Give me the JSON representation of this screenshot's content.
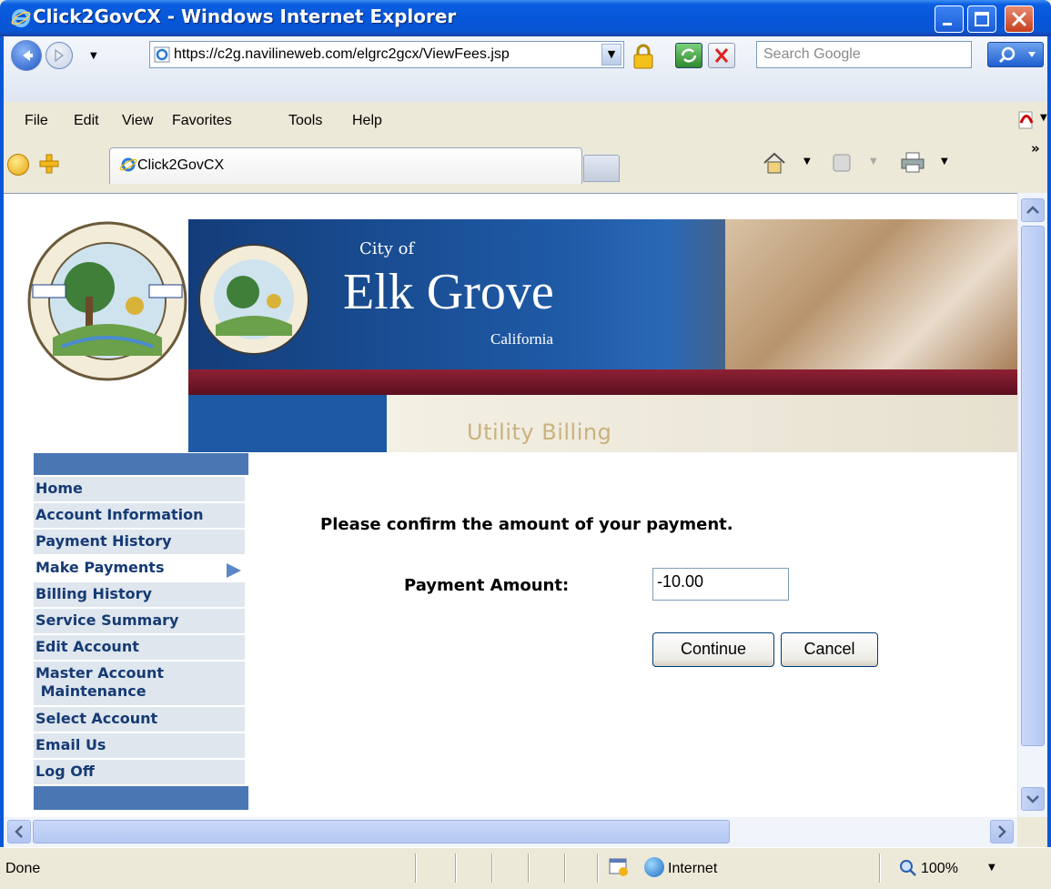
{
  "window": {
    "title": "Click2GovCX - Windows Internet Explorer"
  },
  "address_bar": {
    "url": "https://c2g.navilineweb.com/elgrc2gcx/ViewFees.jsp",
    "search_placeholder": "Search Google"
  },
  "menu": {
    "items": [
      "File",
      "Edit",
      "View",
      "Favorites",
      "Tools",
      "Help"
    ]
  },
  "tab": {
    "label": "Click2GovCX"
  },
  "banner": {
    "city_of": "City of",
    "city_name": "Elk Grove",
    "state": "California",
    "section": "Utility Billing"
  },
  "sidebar": {
    "items": [
      {
        "label": "Home"
      },
      {
        "label": "Account Information"
      },
      {
        "label": "Payment History"
      },
      {
        "label": "Make Payments",
        "active": true
      },
      {
        "label": "Billing History"
      },
      {
        "label": "Service Summary"
      },
      {
        "label": "Edit Account"
      },
      {
        "label": "Master Account\n Maintenance"
      },
      {
        "label": "Select Account"
      },
      {
        "label": "Email Us"
      },
      {
        "label": "Log Off"
      }
    ]
  },
  "main": {
    "confirm_text": "Please confirm the amount of your payment.",
    "payment_label": "Payment Amount:",
    "payment_value": "-10.00",
    "continue_label": "Continue",
    "cancel_label": "Cancel"
  },
  "status": {
    "text": "Done",
    "zone": "Internet",
    "zoom": "100%"
  },
  "colors": {
    "titlebar": "#0a57d6",
    "nav_text": "#163b74",
    "nav_bg": "#dfe6ee",
    "nav_cap": "#4a77b4",
    "banner_maroon": "#8e2034"
  }
}
